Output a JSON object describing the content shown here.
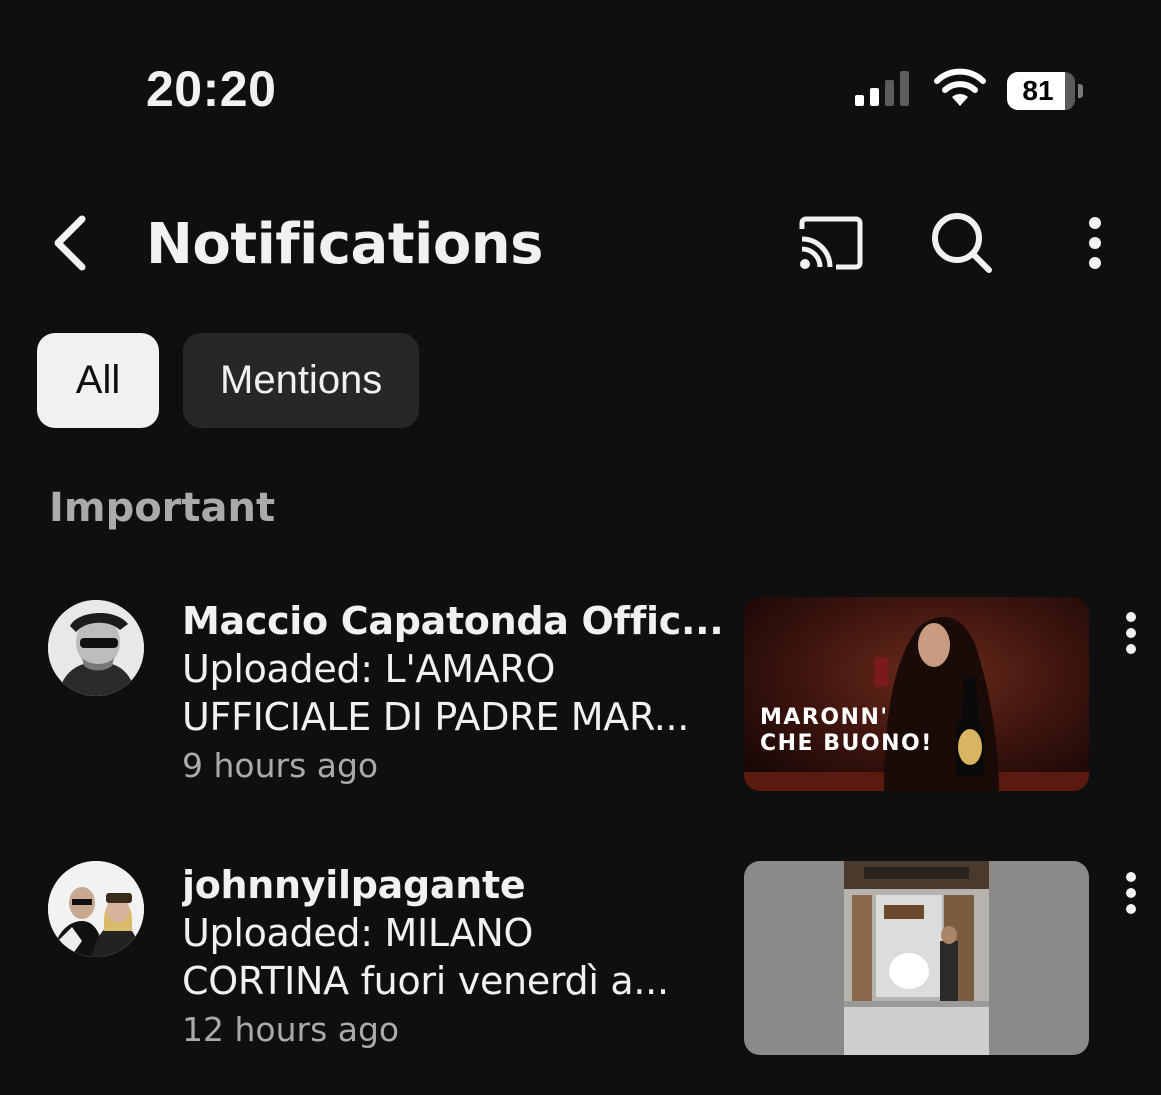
{
  "status_bar": {
    "time": "20:20",
    "battery_percent": "81",
    "battery_level": 0.81,
    "signal_icon": "cellular-signal-icon",
    "wifi_icon": "wifi-icon"
  },
  "header": {
    "back_icon": "chevron-left-icon",
    "title": "Notifications",
    "cast_icon": "cast-icon",
    "search_icon": "search-icon",
    "more_icon": "more-vertical-icon"
  },
  "filters": {
    "chips": [
      {
        "label": "All",
        "active": true
      },
      {
        "label": "Mentions",
        "active": false
      }
    ]
  },
  "section": {
    "label": "Important"
  },
  "notifications": [
    {
      "channel": "Maccio Capatonda Offic...",
      "body_line1": "Uploaded: L'AMARO",
      "body_line2": "UFFICIALE DI PADRE MAR...",
      "time": "9 hours ago",
      "thumbnail_text": "MARONN'\nCHE BUONO!"
    },
    {
      "channel": "johnnyilpagante",
      "body_line1": "Uploaded: MILANO",
      "body_line2": "CORTINA fuori venerdì a...",
      "time": "12 hours ago",
      "thumbnail_text": ""
    }
  ],
  "colors": {
    "background": "#0f0f0f",
    "text_primary": "#f1f1f1",
    "text_secondary": "#aaaaaa",
    "chip_active_bg": "#f1f1f1",
    "chip_inactive_bg": "#272727"
  }
}
